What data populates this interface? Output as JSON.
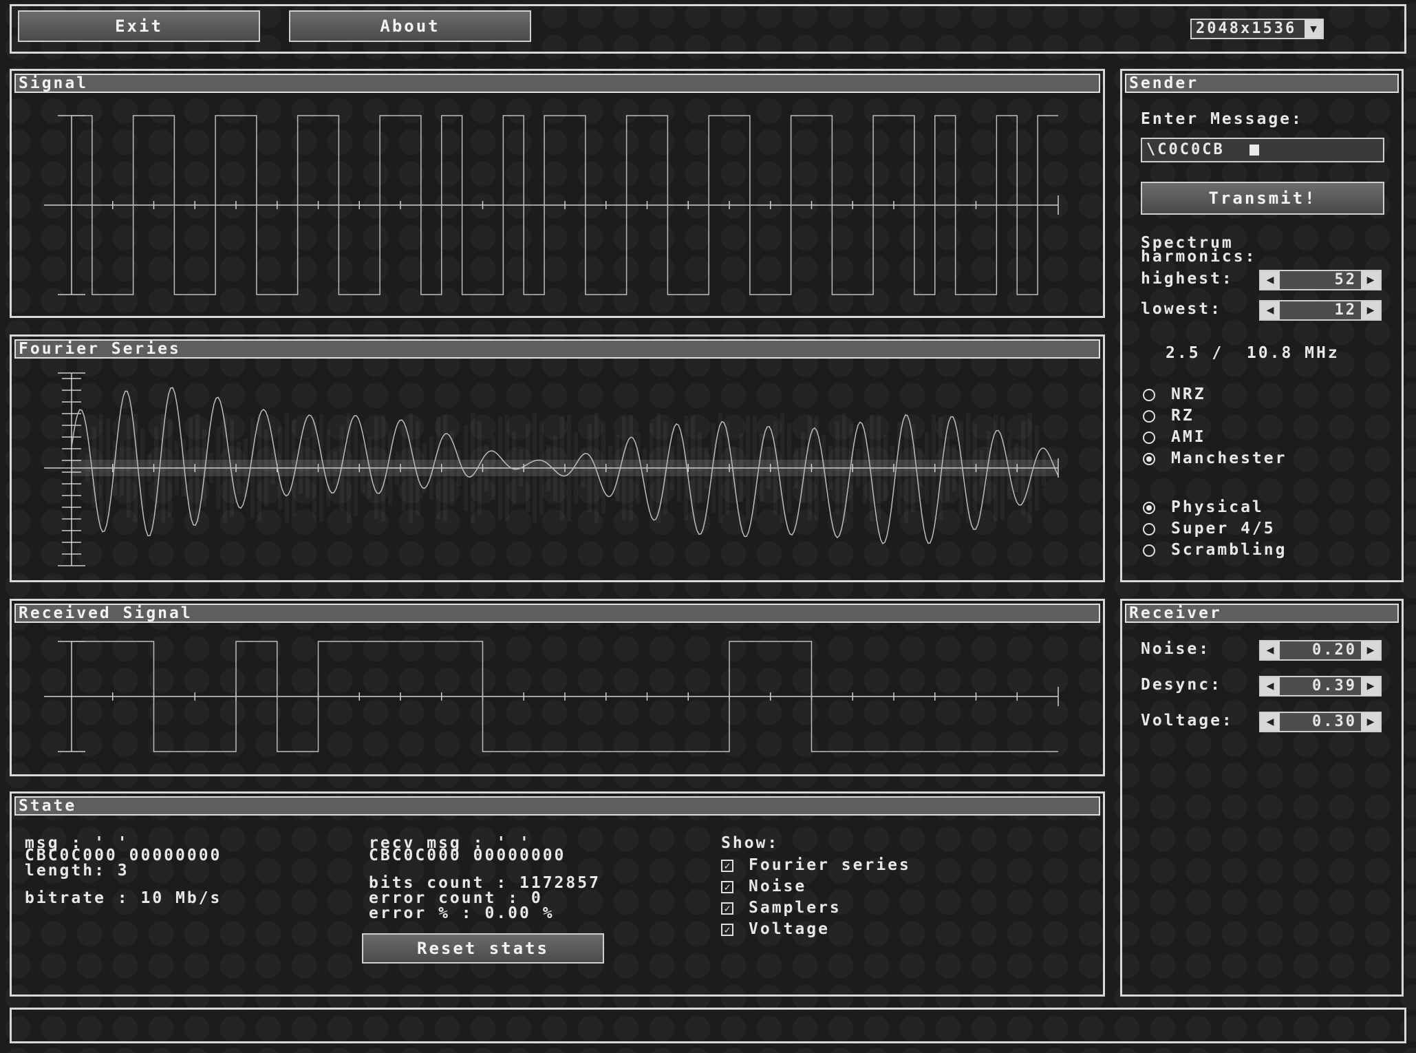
{
  "toolbar": {
    "exit_label": "Exit",
    "about_label": "About",
    "resolution": "2048x1536"
  },
  "panels": {
    "signal_title": "Signal",
    "fourier_title": "Fourier Series",
    "received_title": "Received Signal",
    "state_title": "State",
    "sender_title": "Sender",
    "receiver_title": "Receiver"
  },
  "sender": {
    "enter_label": "Enter Message:",
    "message_value": "\\C0C0CB",
    "transmit_label": "Transmit!",
    "harmonics_label_1": "Spectrum",
    "harmonics_label_2": "harmonics:",
    "highest_label": "highest:",
    "highest_value": "52",
    "lowest_label": "lowest:",
    "lowest_value": "12",
    "freq_readout": "2.5 /  10.8 MHz",
    "encodings": [
      {
        "label": "NRZ",
        "selected": false
      },
      {
        "label": "RZ",
        "selected": false
      },
      {
        "label": "AMI",
        "selected": false
      },
      {
        "label": "Manchester",
        "selected": true
      }
    ],
    "layers": [
      {
        "label": "Physical",
        "selected": true
      },
      {
        "label": "Super 4/5",
        "selected": false
      },
      {
        "label": "Scrambling",
        "selected": false
      }
    ]
  },
  "receiver": {
    "noise_label": "Noise:",
    "noise_value": "0.20",
    "desync_label": "Desync:",
    "desync_value": "0.39",
    "voltage_label": "Voltage:",
    "voltage_value": "0.30"
  },
  "state": {
    "msg_line": "msg : '   '",
    "msg_hex": "CBC0C000 00000000",
    "length_line": "length: 3",
    "bitrate_line": "bitrate : 10 Mb/s",
    "recv_line": "recv msg : '   '",
    "recv_hex": "CBC0C000 00000000",
    "bits_line": "bits count  : 1172857",
    "errors_line": "error count : 0",
    "error_pct_line": "error %     : 0.00 %",
    "reset_label": "Reset stats",
    "show_label": "Show:",
    "show_options": [
      {
        "label": "Fourier series",
        "checked": true
      },
      {
        "label": "Noise",
        "checked": true
      },
      {
        "label": "Samplers",
        "checked": true
      },
      {
        "label": "Voltage",
        "checked": true
      }
    ]
  },
  "signals": {
    "bits": [
      1,
      0,
      1,
      0,
      1,
      0,
      1,
      0,
      1,
      1,
      0,
      0,
      1,
      0,
      1,
      0,
      1,
      0,
      1,
      0,
      1,
      1,
      0,
      0
    ],
    "received_levels": [
      1,
      1,
      0,
      0,
      1,
      0,
      1,
      1,
      1,
      1,
      0,
      0,
      0,
      0,
      0,
      0,
      1,
      1,
      0,
      0,
      0,
      0,
      0,
      0
    ]
  },
  "colors": {
    "background": "#1c1c1c",
    "title_bar": "#5e5e5e",
    "border": "#d8d8d8"
  }
}
